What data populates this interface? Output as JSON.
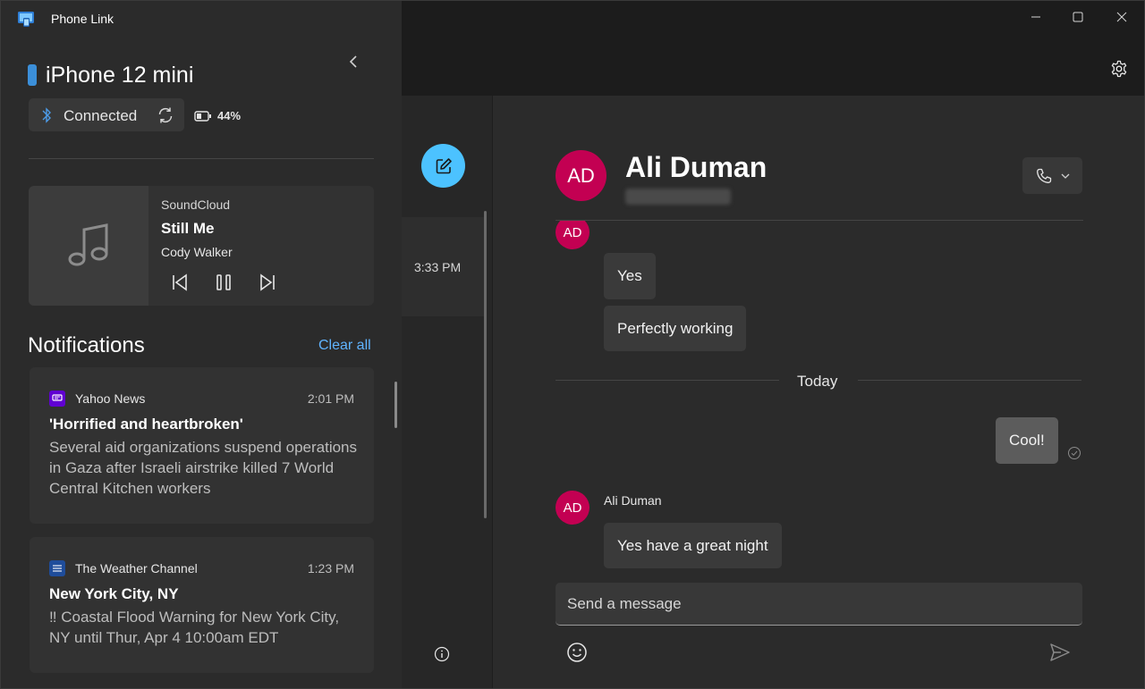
{
  "app": {
    "title": "Phone Link"
  },
  "device": {
    "name": "iPhone 12 mini",
    "status": "Connected",
    "battery": "44%"
  },
  "media": {
    "source": "SoundCloud",
    "title": "Still Me",
    "artist": "Cody Walker"
  },
  "notifications": {
    "header": "Notifications",
    "clear_all": "Clear all",
    "items": [
      {
        "app": "Yahoo News",
        "time": "2:01 PM",
        "title": "'Horrified and heartbroken'",
        "body": "Several aid organizations suspend operations in Gaza after Israeli airstrike killed 7 World Central Kitchen workers"
      },
      {
        "app": "The Weather Channel",
        "time": "1:23 PM",
        "title": "New York City, NY",
        "body": "‼ Coastal Flood Warning for New York City, NY until Thur, Apr 4 10:00am EDT"
      }
    ]
  },
  "conversation_list": {
    "items": [
      {
        "time": "3:33 PM"
      }
    ]
  },
  "chat": {
    "contact_initials": "AD",
    "contact_name": "Ali Duman",
    "day_separator": "Today",
    "messages": [
      {
        "from": "Ali Duman",
        "initials": "AD",
        "text": "Yes"
      },
      {
        "from": "Ali Duman",
        "initials": "AD",
        "text": "Perfectly working"
      },
      {
        "from": "me",
        "text": "Cool!"
      },
      {
        "from": "Ali Duman",
        "initials": "AD",
        "text": "Yes have a great night"
      }
    ],
    "composer_placeholder": "Send a message"
  },
  "colors": {
    "accent": "#4cc2ff",
    "link": "#60b4ff",
    "avatar": "#c30052",
    "phone_icon": "#3b8fd9"
  },
  "icons": [
    "app-icon",
    "chevron-left-icon",
    "bluetooth-icon",
    "sync-icon",
    "battery-icon",
    "music-note-icon",
    "previous-icon",
    "pause-icon",
    "next-icon",
    "yahoo-news-icon",
    "weather-channel-icon",
    "compose-icon",
    "info-icon",
    "minimize-icon",
    "maximize-icon",
    "close-icon",
    "gear-icon",
    "phone-icon",
    "chevron-down-icon",
    "read-check-icon",
    "emoji-icon",
    "send-icon"
  ]
}
